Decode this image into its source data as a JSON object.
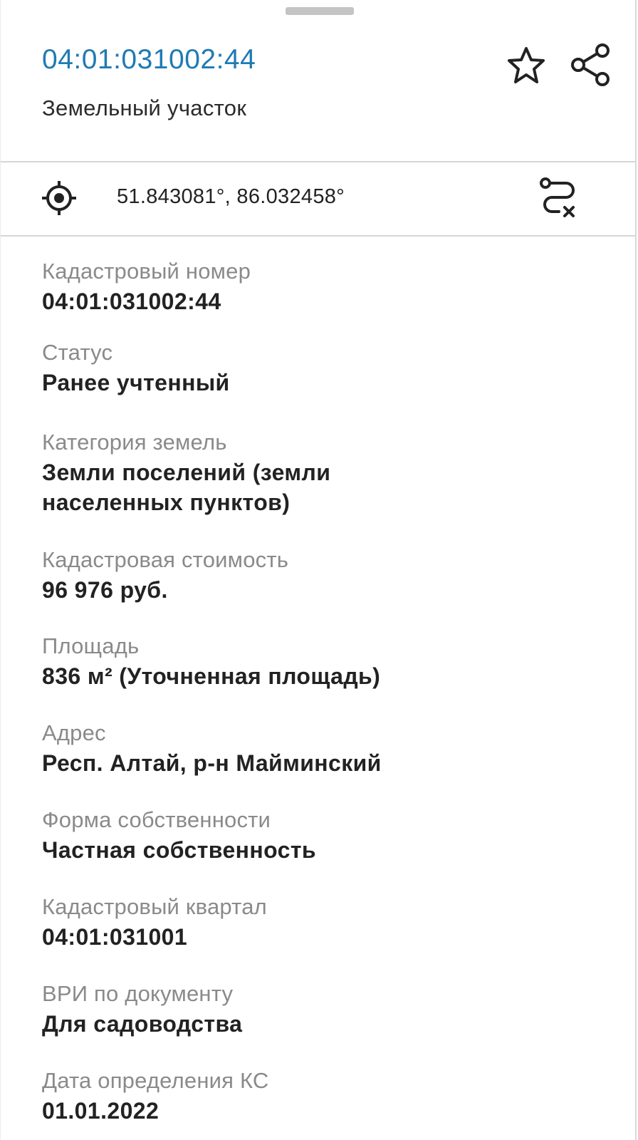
{
  "header": {
    "cadastral_number": "04:01:031002:44",
    "object_type": "Земельный участок"
  },
  "icons": {
    "favorite": "star-outline-icon",
    "share": "share-icon",
    "locate": "crosshair-icon",
    "route": "route-clear-icon"
  },
  "coordinates": {
    "text": "51.843081°, 86.032458°"
  },
  "properties": [
    {
      "label": "Кадастровый номер",
      "value": "04:01:031002:44"
    },
    {
      "label": "Статус",
      "value": "Ранее учтенный"
    },
    {
      "label": "Категория земель",
      "value": "Земли поселений (земли населенных пунктов)"
    },
    {
      "label": "Кадастровая стоимость",
      "value": "96 976 руб."
    },
    {
      "label": "Площадь",
      "value": "836 м² (Уточненная площадь)"
    },
    {
      "label": "Адрес",
      "value": "Респ. Алтай, р-н Майминский"
    },
    {
      "label": "Форма собственности",
      "value": "Частная собственность"
    },
    {
      "label": "Кадастровый квартал",
      "value": "04:01:031001"
    },
    {
      "label": "ВРИ по документу",
      "value": "Для садоводства"
    },
    {
      "label": "Дата определения КС",
      "value": "01.01.2022"
    }
  ],
  "colors": {
    "accent": "#1f7ab4",
    "label": "#8a8a8a",
    "value": "#222222",
    "divider": "#d6d6d6"
  }
}
